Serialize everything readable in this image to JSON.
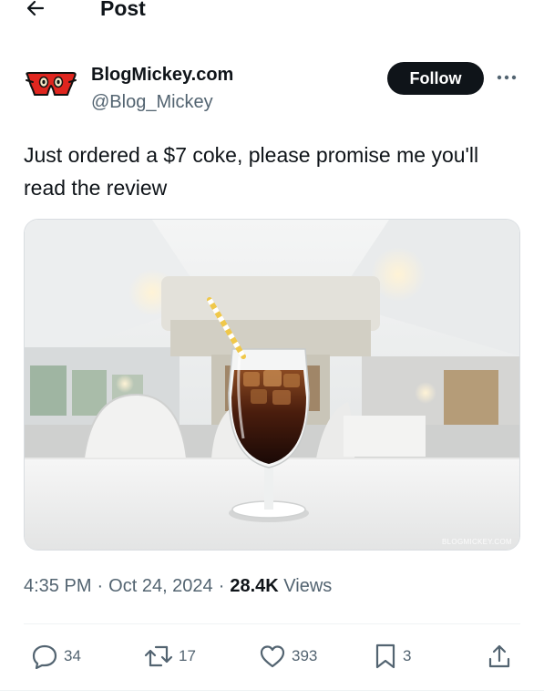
{
  "topbar": {
    "title": "Post"
  },
  "author": {
    "display_name": "BlogMickey.com",
    "handle": "@Blog_Mickey"
  },
  "follow_label": "Follow",
  "post": {
    "text": "Just ordered a $7 coke, please promise me you'll read the review"
  },
  "media": {
    "watermark": "BLOGMICKEY.COM"
  },
  "meta": {
    "time": "4:35 PM",
    "separator": "·",
    "date": "Oct 24, 2024",
    "views_count": "28.4K",
    "views_label": "Views"
  },
  "actions": {
    "replies": "34",
    "reposts": "17",
    "likes": "393",
    "bookmarks": "3"
  },
  "colors": {
    "text": "#0f1419",
    "secondary": "#536471",
    "follow_bg": "#0f1419",
    "avatar_red": "#e0261f"
  }
}
